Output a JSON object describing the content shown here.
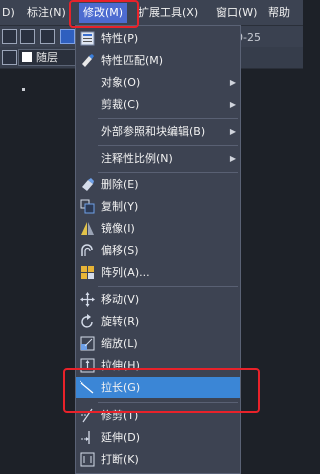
{
  "menubar": {
    "items": [
      {
        "label": "D)"
      },
      {
        "label": "标注(N)"
      },
      {
        "label": "修改(M)"
      },
      {
        "label": "扩展工具(X)"
      },
      {
        "label": "窗口(W)"
      },
      {
        "label": "帮助"
      }
    ]
  },
  "toolbar": {
    "layer_label": "随层",
    "right_field": "0-25"
  },
  "dropdown": {
    "items": [
      {
        "label": "特性(P)",
        "icon": "properties-icon"
      },
      {
        "label": "特性匹配(M)",
        "icon": "match-properties-icon"
      },
      {
        "label": "对象(O)",
        "submenu": true
      },
      {
        "label": "剪裁(C)",
        "submenu": true
      },
      {
        "label": "外部参照和块编辑(B)",
        "submenu": true
      },
      {
        "label": "注释性比例(N)",
        "submenu": true
      },
      {
        "label": "删除(E)",
        "icon": "erase-icon"
      },
      {
        "label": "复制(Y)",
        "icon": "copy-icon"
      },
      {
        "label": "镜像(I)",
        "icon": "mirror-icon"
      },
      {
        "label": "偏移(S)",
        "icon": "offset-icon"
      },
      {
        "label": "阵列(A)...",
        "icon": "array-icon"
      },
      {
        "label": "移动(V)",
        "icon": "move-icon"
      },
      {
        "label": "旋转(R)",
        "icon": "rotate-icon"
      },
      {
        "label": "缩放(L)",
        "icon": "scale-icon"
      },
      {
        "label": "拉伸(H)",
        "icon": "stretch-icon"
      },
      {
        "label": "拉长(G)",
        "icon": "lengthen-icon",
        "highlighted": true
      },
      {
        "label": "修剪(T)",
        "icon": "trim-icon"
      },
      {
        "label": "延伸(D)",
        "icon": "extend-icon"
      },
      {
        "label": "打断(K)",
        "icon": "break-icon"
      }
    ]
  },
  "colors": {
    "highlight": "#3b86d6",
    "annotation_red": "#e8222a",
    "menubar_selected": "#4d6bd0"
  }
}
